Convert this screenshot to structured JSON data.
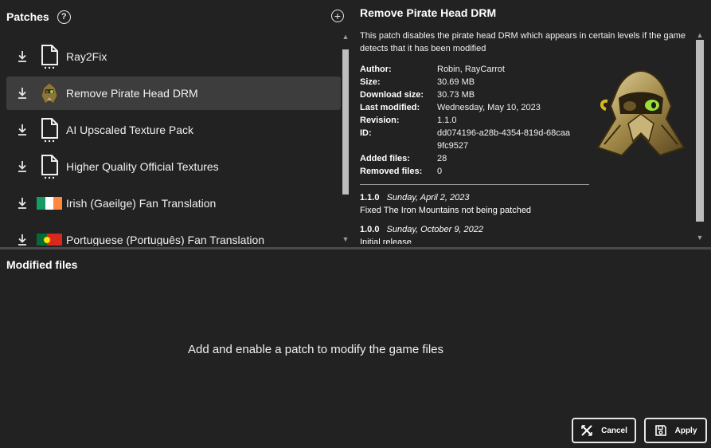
{
  "patches_panel": {
    "title": "Patches",
    "items": [
      {
        "name": "Ray2Fix",
        "thumb": "file-icon"
      },
      {
        "name": "Remove Pirate Head DRM",
        "thumb": "pirate-head-image",
        "selected": true
      },
      {
        "name": "AI Upscaled Texture Pack",
        "thumb": "file-icon"
      },
      {
        "name": "Higher Quality Official Textures",
        "thumb": "file-icon"
      },
      {
        "name": "Irish (Gaeilge) Fan Translation",
        "thumb": "irish-flag-icon"
      },
      {
        "name": "Portuguese (Português) Fan Translation",
        "thumb": "portuguese-flag-icon"
      }
    ]
  },
  "details": {
    "title": "Remove Pirate Head DRM",
    "description": "This patch disables the pirate head DRM which appears in certain levels if the game detects that it has been modified",
    "info": [
      {
        "key": "Author:",
        "value": "Robin, RayCarrot"
      },
      {
        "key": "Size:",
        "value": "30.69 MB"
      },
      {
        "key": "Download size:",
        "value": "30.73 MB"
      },
      {
        "key": "Last modified:",
        "value": "Wednesday, May 10, 2023"
      },
      {
        "key": "Revision:",
        "value": "1.1.0"
      },
      {
        "key": "ID:",
        "value": "dd074196-a28b-4354-819d-68caa9fc9527"
      },
      {
        "key": "Added files:",
        "value": "28"
      },
      {
        "key": "Removed files:",
        "value": "0"
      }
    ],
    "changelog": [
      {
        "version": "1.1.0",
        "date": "Sunday, April 2, 2023",
        "text": "Fixed The Iron Mountains not being patched"
      },
      {
        "version": "1.0.0",
        "date": "Sunday, October 9, 2022",
        "text": "Initial release"
      }
    ]
  },
  "modified_files": {
    "title": "Modified files",
    "empty_message": "Add and enable a patch to modify the game files"
  },
  "buttons": {
    "cancel": "Cancel",
    "apply": "Apply"
  },
  "colors": {
    "background": "#222222",
    "selected_item": "#3d3d3d"
  }
}
